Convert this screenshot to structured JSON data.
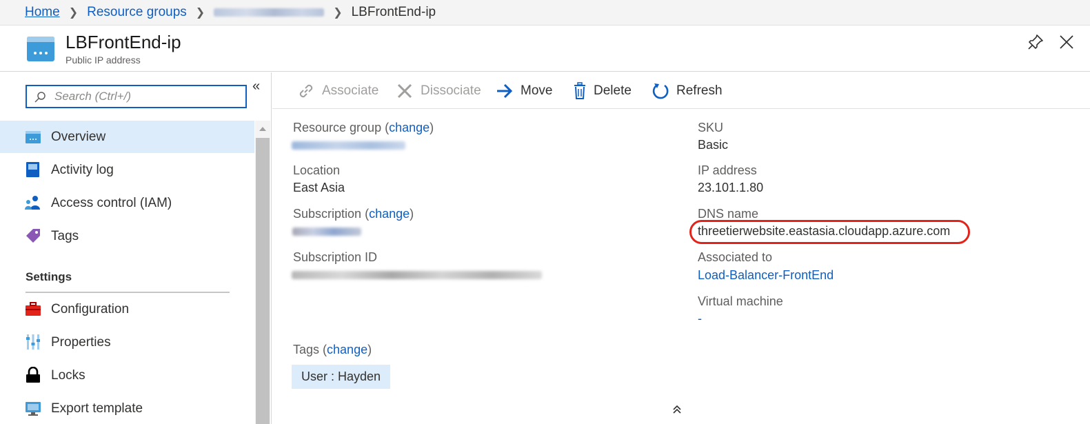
{
  "breadcrumb": {
    "home": "Home",
    "resource_groups": "Resource groups",
    "current": "LBFrontEnd-ip"
  },
  "header": {
    "title": "LBFrontEnd-ip",
    "subtitle": "Public IP address"
  },
  "search": {
    "placeholder": "Search (Ctrl+/)"
  },
  "nav": {
    "items": [
      {
        "label": "Overview",
        "icon": "overview-icon"
      },
      {
        "label": "Activity log",
        "icon": "activity-log-icon"
      },
      {
        "label": "Access control (IAM)",
        "icon": "iam-icon"
      },
      {
        "label": "Tags",
        "icon": "tag-icon"
      }
    ],
    "settings_title": "Settings",
    "settings_items": [
      {
        "label": "Configuration",
        "icon": "toolbox-icon"
      },
      {
        "label": "Properties",
        "icon": "properties-icon"
      },
      {
        "label": "Locks",
        "icon": "lock-icon"
      },
      {
        "label": "Export template",
        "icon": "export-template-icon"
      }
    ]
  },
  "toolbar": {
    "associate": "Associate",
    "dissociate": "Dissociate",
    "move": "Move",
    "delete": "Delete",
    "refresh": "Refresh"
  },
  "essentials": {
    "resource_group_label": "Resource group",
    "change": "change",
    "location_label": "Location",
    "location_value": "East Asia",
    "subscription_label": "Subscription",
    "subscription_id_label": "Subscription ID",
    "sku_label": "SKU",
    "sku_value": "Basic",
    "ip_label": "IP address",
    "ip_value": "23.101.1.80",
    "dns_label": "DNS name",
    "dns_value": "threetierwebsite.eastasia.cloudapp.azure.com",
    "associated_label": "Associated to",
    "associated_value": "Load-Balancer-FrontEnd",
    "vm_label": "Virtual machine",
    "vm_value": "-",
    "tags_label": "Tags",
    "tag_chip": "User : Hayden"
  },
  "colors": {
    "link": "#0f5fc2",
    "active_nav": "#ddecfa",
    "highlight_ring": "#e2231a"
  }
}
